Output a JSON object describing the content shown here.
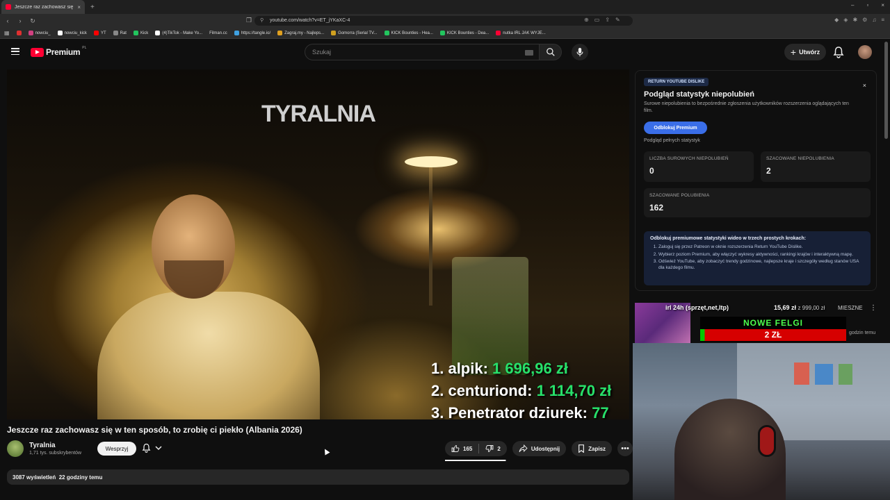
{
  "browser": {
    "tab_title": "Jeszcze raz zachowasz się w t...",
    "url": "youtube.com/watch?v=ET_jYKaXC-4",
    "bookmarks": [
      "nowciu_",
      "nowciu_kick",
      "YT",
      "Rat",
      "Kick",
      "(4)TikTok - Make Yo...",
      "Filman.cc",
      "https://tangle.io/",
      "Zagraj.my - Najleps...",
      "Gomorra (Serial TV...",
      "KICK Bounties - Hea...",
      "KICK Bounties - Dea...",
      "nutka IRL JAK WYJE..."
    ],
    "bookmark_colors": [
      "#e03030",
      "#d04080",
      "#ffffff",
      "#ff0000",
      "#888888",
      "#22c55e",
      "#ffffff",
      "#f0a020",
      "#3fa0e0",
      "#e0a020",
      "#d0a020",
      "#22c55e",
      "#22c55e",
      "#ff0033"
    ]
  },
  "header": {
    "logo_text": "Premium",
    "logo_region": "PL",
    "search_placeholder": "Szukaj",
    "create_label": "Utwórz",
    "brand_color": "#ff0033"
  },
  "video": {
    "watermark": "TYRALNIA",
    "leaderboard": [
      {
        "name": "1. alpik: ",
        "amount": "1 696,96 zł"
      },
      {
        "name": "2. centuriond: ",
        "amount": "1 114,70 zł"
      },
      {
        "name": "3. Penetrator dziurek: ",
        "amount": "77"
      }
    ],
    "title": "Jeszcze raz zachowasz się w ten sposób, to zrobię ci piekło (Albania 2026)",
    "channel_name": "Tyralnia",
    "subscribers": "1,71 tys. subskrybentów",
    "support_label": "Wesprzyj",
    "likes": "165",
    "dislikes": "2",
    "like_ratio": 0.988,
    "share_label": "Udostępnij",
    "save_label": "Zapisz",
    "views": "3087 wyświetleń",
    "posted": "22 godziny temu"
  },
  "ryd": {
    "tag": "RETURN YOUTUBE DISLIKE",
    "close": "×",
    "title": "Podgląd statystyk niepolubień",
    "subtitle": "Surowe niepolubienia to bezpośrednie zgłoszenia użytkowników rozszerzenia oglądających ten film.",
    "unlock_label": "Odblokuj Premium",
    "preview_label": "Podgląd pełnych statystyk",
    "stats": [
      {
        "label": "LICZBA SUROWYCH NIEPOLUBIEŃ",
        "value": "0"
      },
      {
        "label": "SZACOWANE NIEPOLUBIENIA",
        "value": "2"
      },
      {
        "label": "SZACOWANE POLUBIENIA",
        "value": "162"
      }
    ],
    "steps_title": "Odblokuj premiumowe statystyki wideo w trzech prostych krokach:",
    "steps": [
      "Zaloguj się przez Patreon w oknie rozszerzenia Return YouTube Dislike.",
      "Wybierz poziom Premium, aby włączyć wykresy aktywności, rankingi krajów i interaktywną mapę.",
      "Odśwież YouTube, aby zobaczyć trendy godzinowe, najlepsze kraje i szczegóły według stanów USA dla każdego filmu."
    ],
    "accent_color": "#3a6ee8"
  },
  "overlay": {
    "goal_title": "irl 24h (sprzęt,net,ltp)",
    "goal_price": "15,69 zł",
    "goal_target": "z 999,00 zł",
    "banner_title": "NOWE FELGI",
    "banner_amount": "2 ZŁ",
    "goal_progress": 0.02,
    "time_text": "godzin temu",
    "side_label": "MIESZNE"
  }
}
